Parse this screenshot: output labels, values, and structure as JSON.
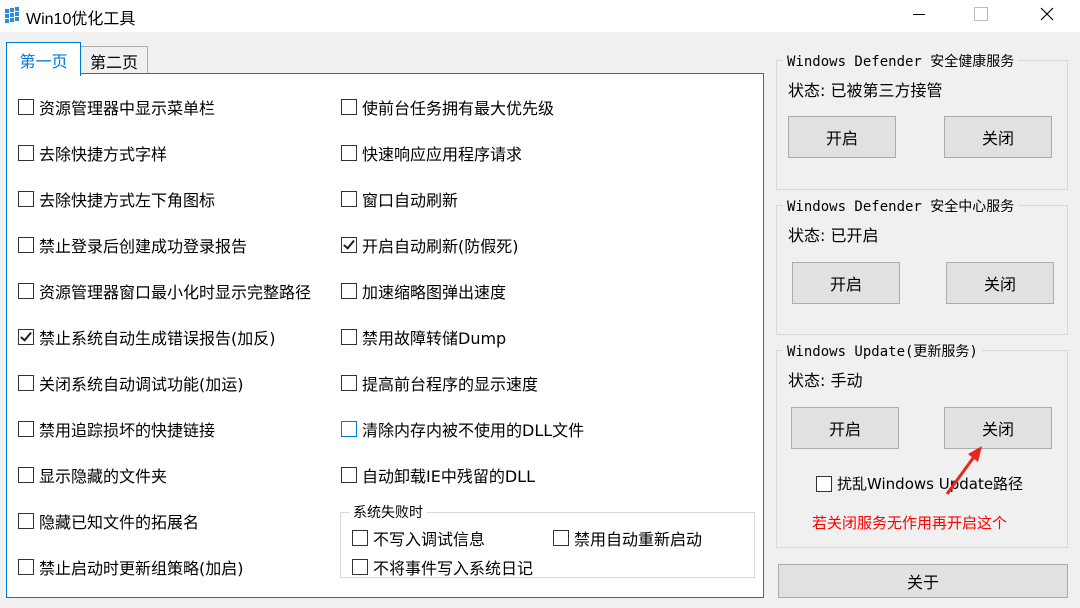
{
  "window": {
    "title": "Win10优化工具",
    "minimize_icon": "minimize-icon",
    "maximize_icon": "maximize-icon",
    "close_icon": "close-icon"
  },
  "tabs": [
    {
      "label": "第一页",
      "active": true
    },
    {
      "label": "第二页",
      "active": false
    }
  ],
  "left_column": [
    {
      "label": "资源管理器中显示菜单栏",
      "checked": false
    },
    {
      "label": "去除快捷方式字样",
      "checked": false
    },
    {
      "label": "去除快捷方式左下角图标",
      "checked": false
    },
    {
      "label": "禁止登录后创建成功登录报告",
      "checked": false
    },
    {
      "label": "资源管理器窗口最小化时显示完整路径",
      "checked": false
    },
    {
      "label": "禁止系统自动生成错误报告(加反)",
      "checked": true
    },
    {
      "label": "关闭系统自动调试功能(加运)",
      "checked": false
    },
    {
      "label": "禁用追踪损坏的快捷链接",
      "checked": false
    },
    {
      "label": "显示隐藏的文件夹",
      "checked": false
    },
    {
      "label": "隐藏已知文件的拓展名",
      "checked": false
    },
    {
      "label": "禁止启动时更新组策略(加启)",
      "checked": false
    }
  ],
  "right_column": [
    {
      "label": "使前台任务拥有最大优先级",
      "checked": false
    },
    {
      "label": "快速响应应用程序请求",
      "checked": false
    },
    {
      "label": "窗口自动刷新",
      "checked": false
    },
    {
      "label": "开启自动刷新(防假死)",
      "checked": true
    },
    {
      "label": "加速缩略图弹出速度",
      "checked": false
    },
    {
      "label": "禁用故障转储Dump",
      "checked": false
    },
    {
      "label": "提高前台程序的显示速度",
      "checked": false
    },
    {
      "label": "清除内存内被不使用的DLL文件",
      "checked": false
    },
    {
      "label": "自动卸载IE中残留的DLL",
      "checked": false
    }
  ],
  "failure_group": {
    "title": "系统失败时",
    "no_debug": "不写入调试信息",
    "no_restart": "禁用自动重新启动",
    "no_event_log": "不将事件写入系统日记"
  },
  "services": [
    {
      "title": "Windows Defender 安全健康服务",
      "status": "状态: 已被第三方接管",
      "on": "开启",
      "off": "关闭"
    },
    {
      "title": "Windows Defender 安全中心服务",
      "status": "状态: 已开启",
      "on": "开启",
      "off": "关闭"
    },
    {
      "title": "Windows Update(更新服务)",
      "status": "状态: 手动",
      "on": "开启",
      "off": "关闭"
    }
  ],
  "update_path_checkbox": {
    "label": "扰乱Windows Update路径",
    "checked": false
  },
  "warning_text": "若关闭服务无作用再开启这个",
  "about_button": "关于",
  "colors": {
    "accent": "#0078d7",
    "warning": "#ff0000",
    "annotation_arrow": "#e8271c"
  }
}
